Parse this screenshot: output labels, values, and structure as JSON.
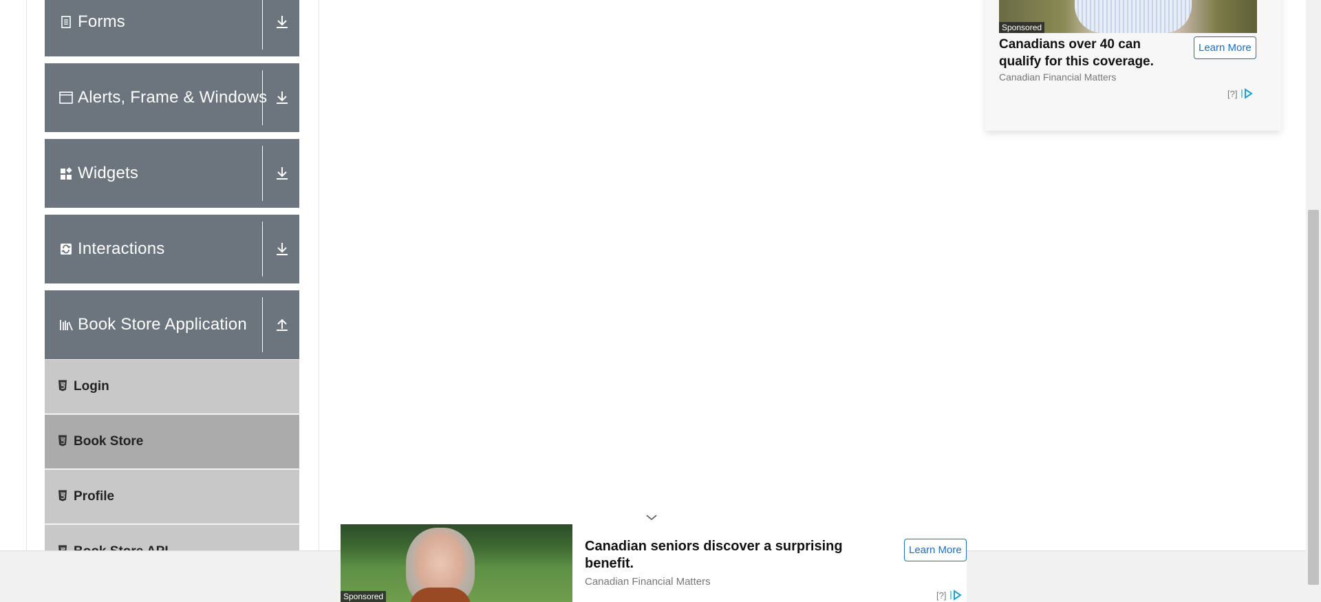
{
  "nav": {
    "groups": [
      {
        "label": "Forms",
        "icon": "document-icon",
        "state": "collapsed"
      },
      {
        "label": "Alerts, Frame & Windows",
        "icon": "window-icon",
        "state": "collapsed"
      },
      {
        "label": "Widgets",
        "icon": "widgets-icon",
        "state": "collapsed"
      },
      {
        "label": "Interactions",
        "icon": "interactions-icon",
        "state": "collapsed"
      },
      {
        "label": "Book Store Application",
        "icon": "books-icon",
        "state": "expanded"
      }
    ],
    "book_store_items": [
      {
        "label": "Login",
        "active": false
      },
      {
        "label": "Book Store",
        "active": true
      },
      {
        "label": "Profile",
        "active": false
      },
      {
        "label": "Book Store API",
        "active": false
      }
    ]
  },
  "ad_top": {
    "sponsored": "Sponsored",
    "title": "Canadians over 40 can qualify for this coverage.",
    "source": "Canadian Financial Matters",
    "button": "Learn More",
    "help": "[?]"
  },
  "ad_bottom": {
    "sponsored": "Sponsored",
    "title": "Canadian seniors discover a surprising benefit.",
    "source": "Canadian Financial Matters",
    "button": "Learn More",
    "help": "[?]"
  },
  "colors": {
    "nav_header": "#6c757d",
    "submenu": "#c8c8c8",
    "submenu_active": "#ababab",
    "accent": "#1c6ec4"
  }
}
